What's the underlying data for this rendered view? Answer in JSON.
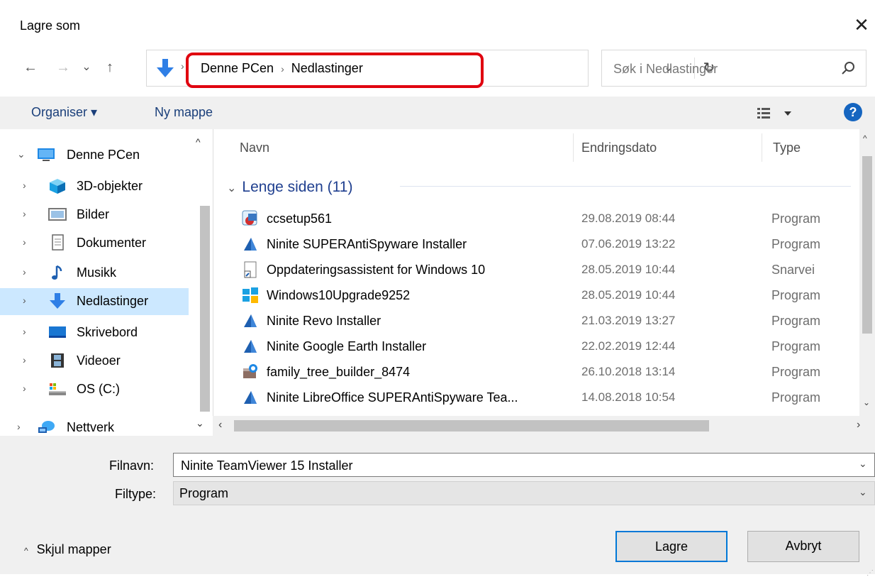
{
  "window": {
    "title": "Lagre som"
  },
  "nav": {
    "back": "←",
    "forward": "→",
    "recent": "⌄",
    "up": "↑"
  },
  "address": {
    "crumbs": [
      "Denne PCen",
      "Nedlastinger"
    ],
    "refresh": "↻"
  },
  "search": {
    "placeholder": "Søk i Nedlastinger"
  },
  "toolbar": {
    "organize": "Organiser ▾",
    "new_folder": "Ny mappe",
    "help": "?"
  },
  "sidebar": {
    "items": [
      {
        "label": "Denne PCen",
        "icon": "monitor-icon",
        "expanded": true
      },
      {
        "label": "3D-objekter",
        "icon": "cube-icon"
      },
      {
        "label": "Bilder",
        "icon": "pictures-icon"
      },
      {
        "label": "Dokumenter",
        "icon": "document-icon"
      },
      {
        "label": "Musikk",
        "icon": "music-note-icon"
      },
      {
        "label": "Nedlastinger",
        "icon": "download-arrow-icon",
        "selected": true
      },
      {
        "label": "Skrivebord",
        "icon": "desktop-icon"
      },
      {
        "label": "Videoer",
        "icon": "film-icon"
      },
      {
        "label": "OS (C:)",
        "icon": "drive-icon"
      },
      {
        "label": "Nettverk",
        "icon": "network-icon"
      }
    ]
  },
  "columns": {
    "name": "Navn",
    "date": "Endringsdato",
    "type": "Type"
  },
  "group": {
    "label": "Lenge siden (11)"
  },
  "files": [
    {
      "name": "ccsetup561",
      "date": "29.08.2019 08:44",
      "type": "Program",
      "icon": "ccleaner-setup-icon"
    },
    {
      "name": "Ninite SUPERAntiSpyware Installer",
      "date": "07.06.2019 13:22",
      "type": "Program",
      "icon": "ninite-icon"
    },
    {
      "name": "Oppdateringsassistent for Windows 10",
      "date": "28.05.2019 10:44",
      "type": "Snarvei",
      "icon": "shortcut-icon"
    },
    {
      "name": "Windows10Upgrade9252",
      "date": "28.05.2019 10:44",
      "type": "Program",
      "icon": "windows-logo-icon"
    },
    {
      "name": "Ninite Revo Installer",
      "date": "21.03.2019 13:27",
      "type": "Program",
      "icon": "ninite-icon"
    },
    {
      "name": "Ninite Google Earth Installer",
      "date": "22.02.2019 12:44",
      "type": "Program",
      "icon": "ninite-icon"
    },
    {
      "name": "family_tree_builder_8474",
      "date": "26.10.2018 13:14",
      "type": "Program",
      "icon": "installer-icon"
    },
    {
      "name": "Ninite LibreOffice SUPERAntiSpyware Tea...",
      "date": "14.08.2018 10:54",
      "type": "Program",
      "icon": "ninite-icon"
    }
  ],
  "footer": {
    "filename_label": "Filnavn:",
    "filename_value": "Ninite TeamViewer 15 Installer",
    "filetype_label": "Filtype:",
    "filetype_value": "Program",
    "hide_folders": "Skjul mapper",
    "save": "Lagre",
    "cancel": "Avbryt"
  },
  "colors": {
    "accent": "#0078d7",
    "selection": "#cce8ff",
    "highlight": "#e0000f",
    "link": "#1a3f7a"
  }
}
